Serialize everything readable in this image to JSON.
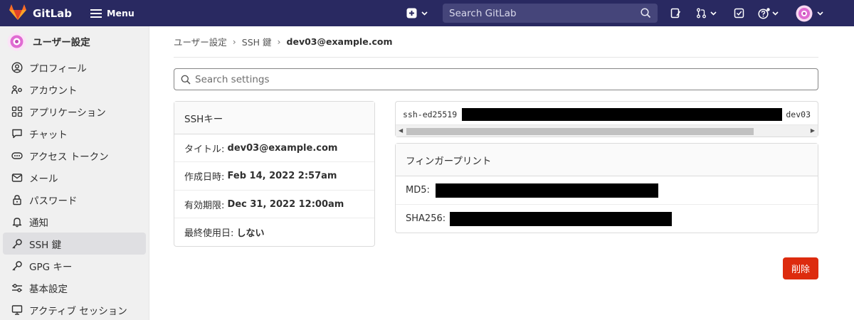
{
  "navbar": {
    "brand": "GitLab",
    "menu_label": "Menu",
    "search_placeholder": "Search GitLab",
    "colors": {
      "background": "#292961",
      "search_bg": "#45457a"
    }
  },
  "sidebar": {
    "title": "ユーザー設定",
    "items": [
      {
        "label": "プロフィール",
        "icon": "profile-icon"
      },
      {
        "label": "アカウント",
        "icon": "account-icon"
      },
      {
        "label": "アプリケーション",
        "icon": "applications-icon"
      },
      {
        "label": "チャット",
        "icon": "chat-icon"
      },
      {
        "label": "アクセス トークン",
        "icon": "token-icon"
      },
      {
        "label": "メール",
        "icon": "mail-icon"
      },
      {
        "label": "パスワード",
        "icon": "lock-icon"
      },
      {
        "label": "通知",
        "icon": "bell-icon"
      },
      {
        "label": "SSH 鍵",
        "icon": "key-icon",
        "active": true
      },
      {
        "label": "GPG キー",
        "icon": "key-icon"
      },
      {
        "label": "基本設定",
        "icon": "preferences-icon"
      },
      {
        "label": "アクティブ セッション",
        "icon": "monitor-icon"
      }
    ]
  },
  "breadcrumb": {
    "items": [
      "ユーザー設定",
      "SSH 鍵"
    ],
    "current": "dev03@example.com"
  },
  "settings_search": {
    "placeholder": "Search settings"
  },
  "ssh_key_card": {
    "header": "SSHキー",
    "rows": [
      {
        "label": "タイトル:",
        "value": "dev03@example.com"
      },
      {
        "label": "作成日時:",
        "value": "Feb 14, 2022 2:57am"
      },
      {
        "label": "有効期限:",
        "value": "Dec 31, 2022 12:00am"
      },
      {
        "label": "最終使用日:",
        "value": "しない"
      }
    ]
  },
  "key_content": {
    "prefix": "ssh-ed25519",
    "suffix": "dev03"
  },
  "fingerprint_card": {
    "header": "フィンガープリント",
    "md5_label": "MD5:",
    "sha256_label": "SHA256:"
  },
  "delete_button": {
    "label": "削除",
    "color": "#dd2b0e"
  }
}
